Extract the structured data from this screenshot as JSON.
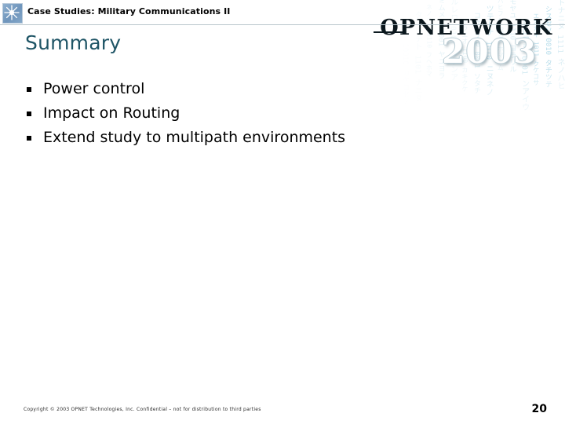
{
  "slide": {
    "page_number": "20",
    "background_color": "#ffffff"
  },
  "header": {
    "icon": "starburst-icon",
    "title": "Case Studies: Military Communications II",
    "title_color": "#000000",
    "rule_color": "#b9c6cc",
    "icon_color": "#7a9ec4"
  },
  "brand_logo": {
    "wordmark": "OPNETWORK",
    "year": "2003",
    "wordmark_color": "#0b171d",
    "year_color": "#ffffff",
    "matrix_color": "#9fd2e4",
    "matrix_columns": [
      "アキサテナ 01101 ハマヤラ",
      "ワヲン 10010 カケコセソ",
      "タチツテト 1101 ナニヌ",
      "ネノハヒ 0110 フヘホマ",
      "ミムメモ 1001 ヤユヨラ",
      "リルレロ 0101 ワヲンア",
      "イウエオ 1100 カキクケ",
      "コサシスセ 0011 ソタチ",
      "ツテトナ 1010 ニヌネノ",
      "ハヒフヘ 0100 ホマミム",
      "メモヤユ 1110 ヨラリル",
      "レロワヲ 0001 ンアイウ",
      "エオカキ 1011 クケコサ",
      "シスセソ 0010 タチツテ",
      "トナニヌ 1111 ネノハヒ"
    ]
  },
  "content": {
    "title": "Summary",
    "title_color": "#1f5566",
    "bullets": [
      {
        "text": "Power control"
      },
      {
        "text": "Impact on Routing"
      },
      {
        "text": "Extend study to multipath environments"
      }
    ]
  },
  "footer": {
    "copyright": "Copyright © 2003 OPNET Technologies, Inc.  Confidential – not for distribution to third parties",
    "page_number": "20"
  }
}
